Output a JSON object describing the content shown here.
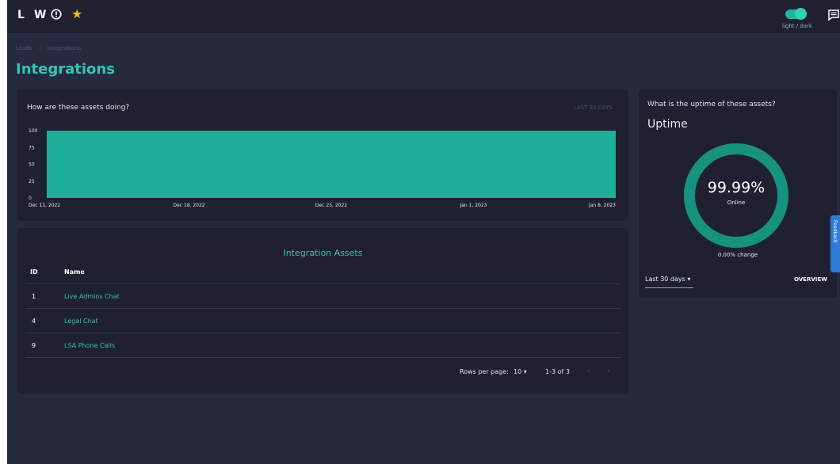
{
  "topbar": {
    "logo_letters": [
      "L",
      "W"
    ],
    "icons": [
      "info-icon",
      "star-icon",
      "chat-icon"
    ],
    "theme_toggle_label": "light / dark",
    "star_color": "#f0b81a"
  },
  "breadcrumb": [
    "Leads",
    "Integrations"
  ],
  "page": {
    "title": "Integrations"
  },
  "colors": {
    "accent": "#2fc4ac",
    "background": "#272a3f",
    "card": "#1f2132",
    "link": "#2fc4ac"
  },
  "chart_data": {
    "type": "area",
    "title": "How are these assets doing?",
    "range_label": "LAST 30 DAYS",
    "x": [
      "Dec 11, 2022",
      "Dec 18, 2022",
      "Dec 25, 2022",
      "Jan 1, 2023",
      "Jan 8, 2023"
    ],
    "y_ticks": [
      0,
      25,
      50,
      75,
      100
    ],
    "ylim": [
      0,
      100
    ],
    "series": [
      {
        "values": [
          99.99,
          99.99,
          99.99,
          99.99,
          99.99
        ]
      }
    ],
    "fill_color": "#1fae98",
    "grid": false
  },
  "assets_table": {
    "title": "Integration Assets",
    "columns": [
      "ID",
      "Name"
    ],
    "rows": [
      {
        "id": "1",
        "name": "Live Admins Chat"
      },
      {
        "id": "4",
        "name": "Legal Chat"
      },
      {
        "id": "9",
        "name": "LSA Phone Calls"
      }
    ],
    "rows_per_page_label": "Rows per page:",
    "rows_per_page_value": "10 ▾",
    "page_range": "1-3 of 3"
  },
  "uptime": {
    "question": "What is the uptime of these assets?",
    "title": "Uptime",
    "value": "99.99%",
    "status": "Online",
    "change": "0.00% change",
    "period": "Last 30 days ▾",
    "overview_label": "OVERVIEW",
    "ring_color": "#17927f"
  },
  "side_tab": {
    "label": "Feedback"
  }
}
